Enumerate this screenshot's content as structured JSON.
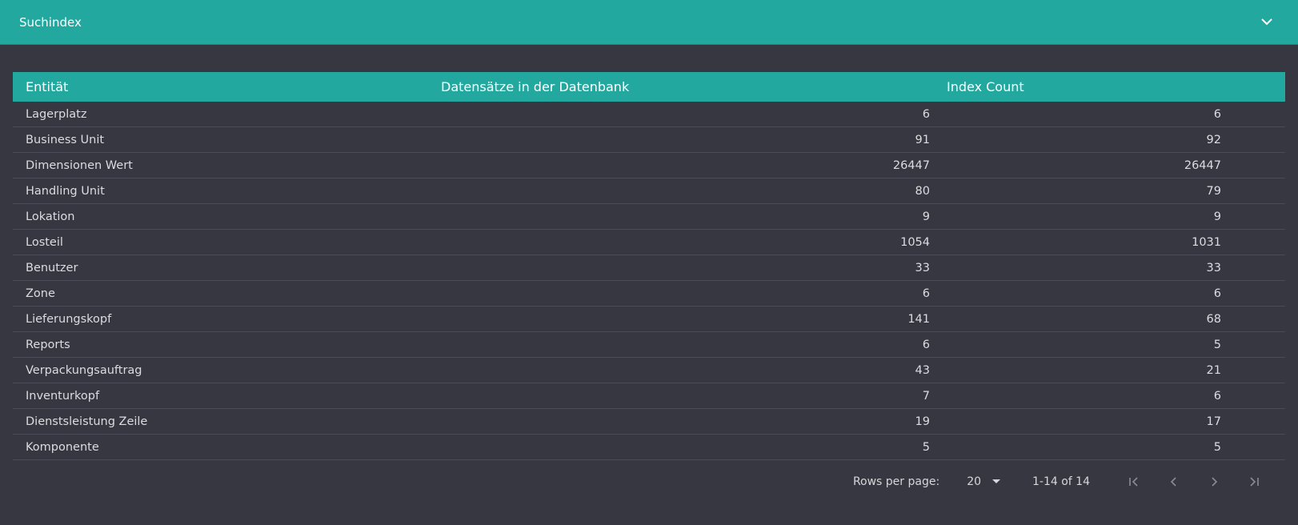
{
  "panel": {
    "title": "Suchindex",
    "toggle_icon": "chevron-down-icon"
  },
  "table": {
    "columns": [
      "Entität",
      "Datensätze in der Datenbank",
      "Index Count"
    ],
    "rows": [
      {
        "entity": "Lagerplatz",
        "db": "6",
        "index": "6"
      },
      {
        "entity": "Business Unit",
        "db": "91",
        "index": "92"
      },
      {
        "entity": "Dimensionen Wert",
        "db": "26447",
        "index": "26447"
      },
      {
        "entity": "Handling Unit",
        "db": "80",
        "index": "79"
      },
      {
        "entity": "Lokation",
        "db": "9",
        "index": "9"
      },
      {
        "entity": "Losteil",
        "db": "1054",
        "index": "1031"
      },
      {
        "entity": "Benutzer",
        "db": "33",
        "index": "33"
      },
      {
        "entity": "Zone",
        "db": "6",
        "index": "6"
      },
      {
        "entity": "Lieferungskopf",
        "db": "141",
        "index": "68"
      },
      {
        "entity": "Reports",
        "db": "6",
        "index": "5"
      },
      {
        "entity": "Verpackungsauftrag",
        "db": "43",
        "index": "21"
      },
      {
        "entity": "Inventurkopf",
        "db": "7",
        "index": "6"
      },
      {
        "entity": "Dienstsleistung Zeile",
        "db": "19",
        "index": "17"
      },
      {
        "entity": "Komponente",
        "db": "5",
        "index": "5"
      }
    ]
  },
  "pagination": {
    "rows_per_page_label": "Rows per page:",
    "rows_per_page_value": "20",
    "range_text": "1-14 of 14"
  },
  "colors": {
    "accent": "#22a89f",
    "background": "#363740",
    "row_divider": "#4a4b55"
  }
}
